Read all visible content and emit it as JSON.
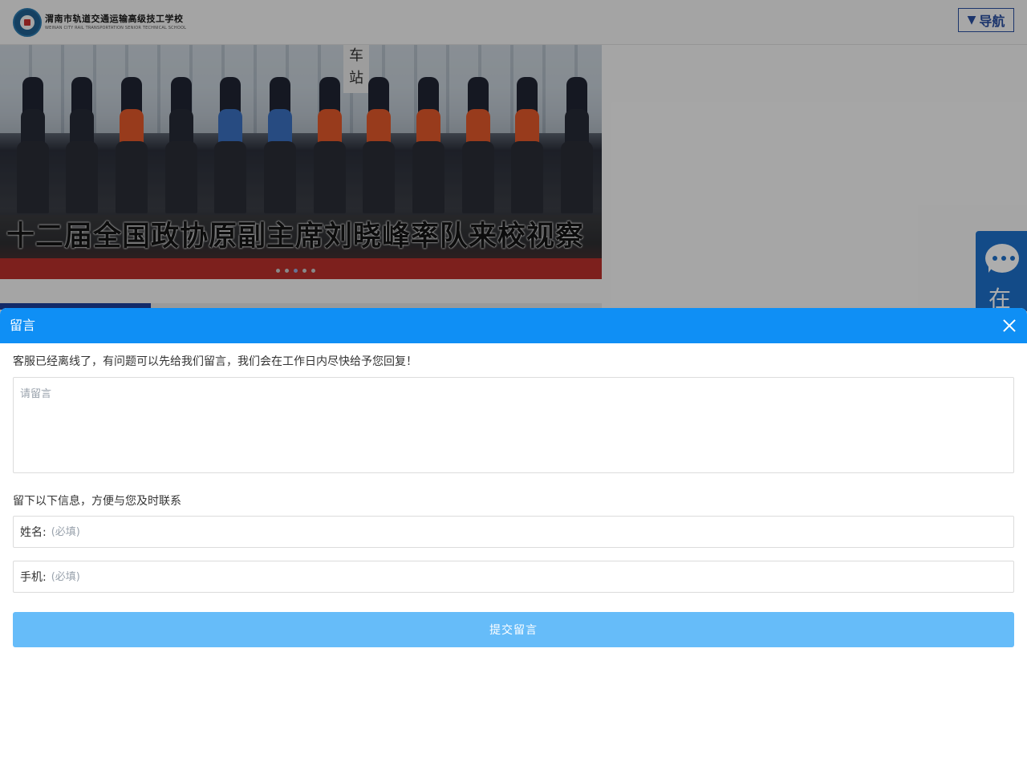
{
  "site": {
    "school_name_cn": "渭南市轨道交通运输高级技工学校",
    "school_name_en": "WEINAN CITY RAIL TRANSPORTATION SENIOR TECHNICAL SCHOOL",
    "nav_label": "导航",
    "nav_icon": "triangle-down-icon"
  },
  "banner": {
    "sign_text": "车站",
    "caption": "十二届全国政协原副主席刘晓峰率队来校视察",
    "slide_count": 5,
    "active_slide": 3
  },
  "float_chat": {
    "icon": "chat-bubble-icon",
    "label": "在"
  },
  "modal": {
    "title": "留言",
    "close_icon": "close-icon",
    "notice": "客服已经离线了，有问题可以先给我们留言，我们会在工作日内尽快给予您回复！",
    "message_placeholder": "请留言",
    "message_value": "",
    "info_label": "留下以下信息，方便与您及时联系",
    "name_label": "姓名:",
    "name_placeholder": "(必填)",
    "name_value": "",
    "phone_label": "手机:",
    "phone_placeholder": "(必填)",
    "phone_value": "",
    "submit_label": "提交留言"
  },
  "colors": {
    "header_blue": "#0f8ff5",
    "submit_blue": "#66bcf9",
    "nav_blue": "#2a4ea0",
    "float_blue": "#1d6fc9"
  }
}
